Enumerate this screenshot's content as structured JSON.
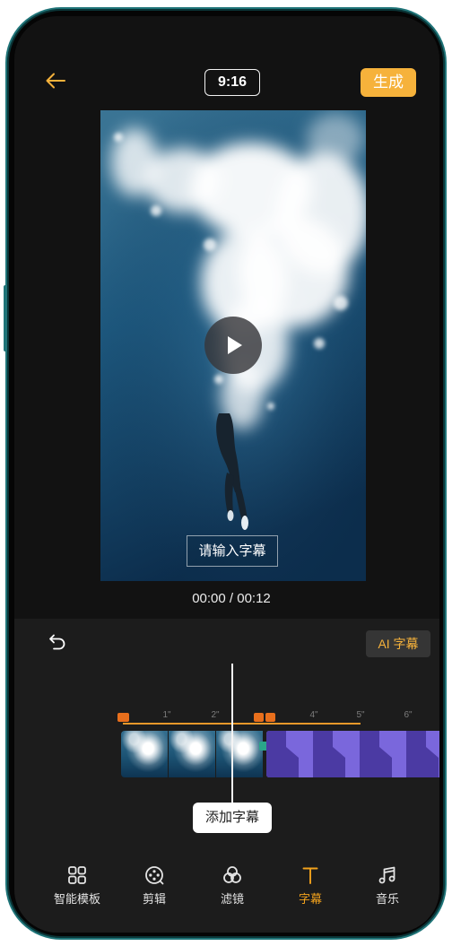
{
  "colors": {
    "accent": "#f6b23b",
    "active": "#f2a21c",
    "screen_bg": "#121212",
    "panel_bg": "#1c1c1c",
    "marker": "#e86f1c",
    "track_line": "#e8982a",
    "clip_purple": "#7a67dc",
    "clip_purple_dark": "#4b3aa3",
    "frame": "#1f7478"
  },
  "header": {
    "back_icon": "arrow-left-icon",
    "aspect_ratio": "9:16",
    "generate_label": "生成"
  },
  "preview": {
    "play_icon": "play-icon",
    "subtitle_placeholder": "请输入字幕",
    "time": "00:00 / 00:12"
  },
  "editor": {
    "undo_icon": "undo-icon",
    "ai_subtitle_label": "AI 字幕",
    "ruler_ticks": [
      "1\"",
      "2\"",
      "4\"",
      "5\"",
      "6\""
    ],
    "add_subtitle_label": "添加字幕"
  },
  "bottom_nav": {
    "active_index": 3,
    "items": [
      {
        "label": "智能模板",
        "icon": "template-grid-icon"
      },
      {
        "label": "剪辑",
        "icon": "film-reel-icon"
      },
      {
        "label": "滤镜",
        "icon": "filter-circles-icon"
      },
      {
        "label": "字幕",
        "icon": "text-t-icon"
      },
      {
        "label": "音乐",
        "icon": "music-note-icon"
      }
    ]
  }
}
